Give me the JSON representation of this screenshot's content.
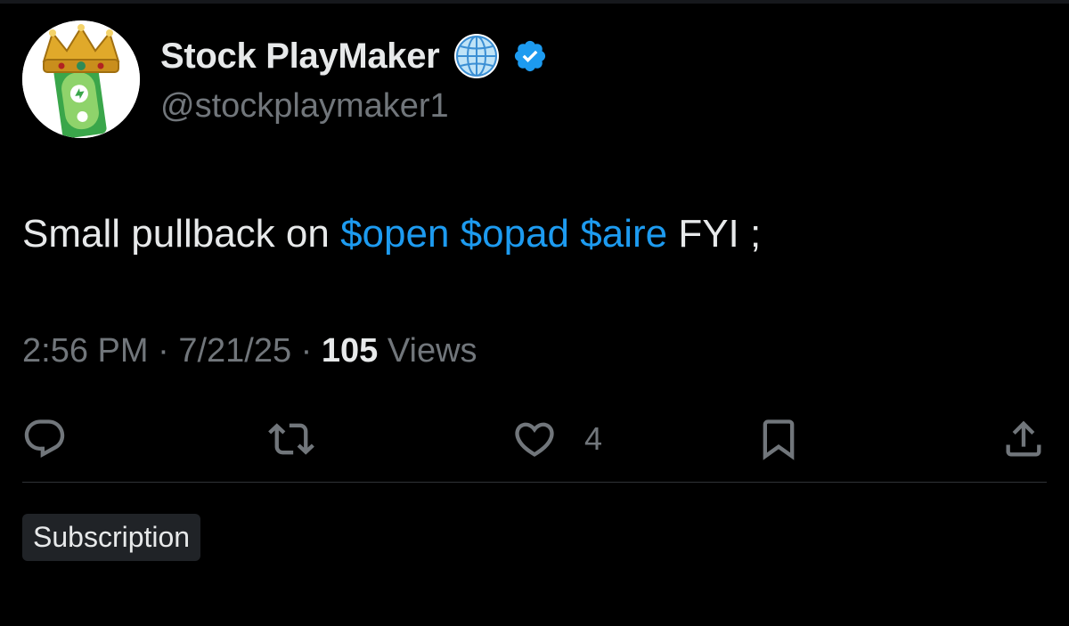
{
  "author": {
    "display_name": "Stock PlayMaker",
    "handle": "@stockplaymaker1",
    "badges": [
      "globe-icon",
      "verified-badge-icon"
    ],
    "verified_color": "#1d9bf0"
  },
  "tweet": {
    "parts": [
      {
        "text": "Small pullback on ",
        "type": "text"
      },
      {
        "text": "$open",
        "type": "cashtag"
      },
      {
        "text": " ",
        "type": "text"
      },
      {
        "text": "$opad",
        "type": "cashtag"
      },
      {
        "text": " ",
        "type": "text"
      },
      {
        "text": "$aire",
        "type": "cashtag"
      },
      {
        "text": " FYI ;",
        "type": "text"
      }
    ]
  },
  "meta": {
    "time": "2:56 PM",
    "separator": " · ",
    "date": "7/21/25",
    "views_count": "105",
    "views_label": " Views"
  },
  "actions": {
    "reply_icon": "reply-icon",
    "retweet_icon": "retweet-icon",
    "like_icon": "heart-icon",
    "like_count": "4",
    "bookmark_icon": "bookmark-icon",
    "share_icon": "share-icon"
  },
  "subscription_label": "Subscription",
  "colors": {
    "background": "#000000",
    "text": "#e7e9ea",
    "muted": "#71767b",
    "link": "#1d9bf0"
  }
}
